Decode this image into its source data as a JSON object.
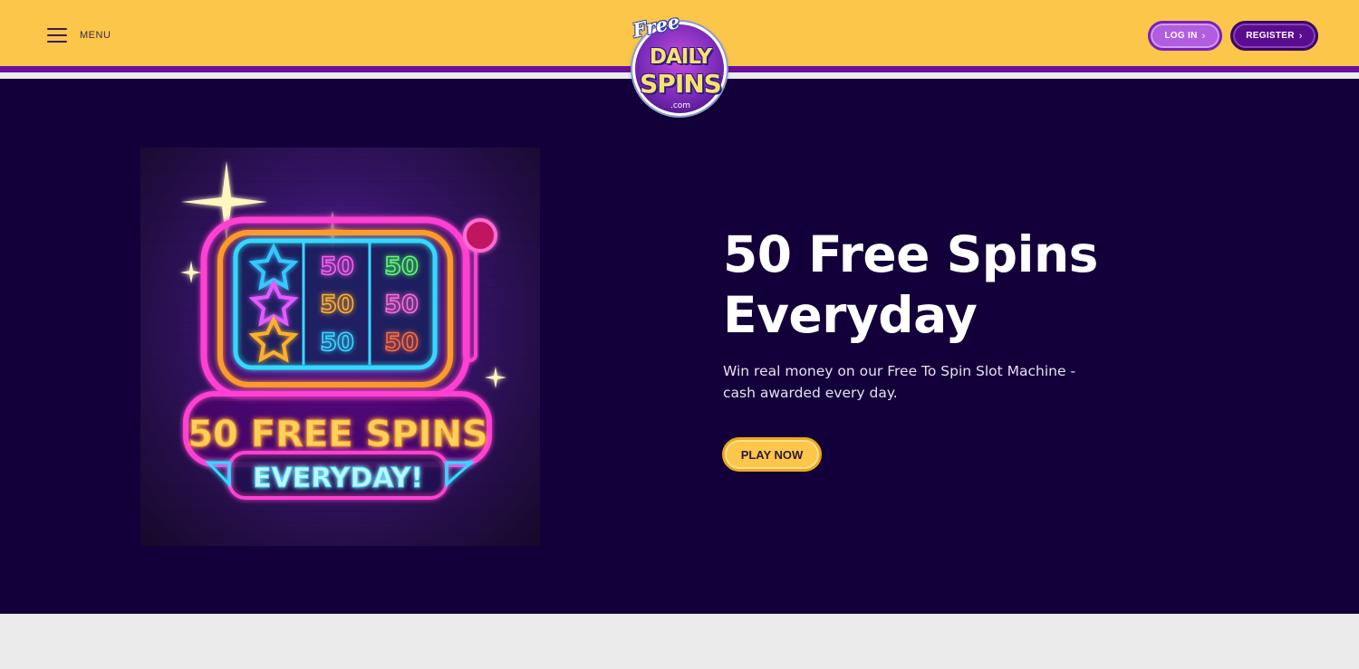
{
  "header": {
    "menu_label": "MENU",
    "login_label": "LOG IN",
    "register_label": "REGISTER",
    "chevron": "›"
  },
  "logo": {
    "free": "Free",
    "daily": "DAILY",
    "spins": "SPINS",
    "com": ".com"
  },
  "hero": {
    "title": "50 Free Spins Everyday",
    "subtitle": "Win real money on our Free To Spin Slot Machine - cash awarded every day.",
    "cta_label": "PLAY NOW",
    "image": {
      "banner_line1": "50 FREE SPINS",
      "banner_line2": "EVERYDAY!",
      "reel_values": [
        "50",
        "50",
        "50",
        "50",
        "50",
        "50"
      ]
    }
  },
  "colors": {
    "header_bg": "#fbc64a",
    "accent_purple": "#6a0f9e",
    "hero_bg": "#13003a",
    "cta_yellow": "#fbc64a"
  }
}
